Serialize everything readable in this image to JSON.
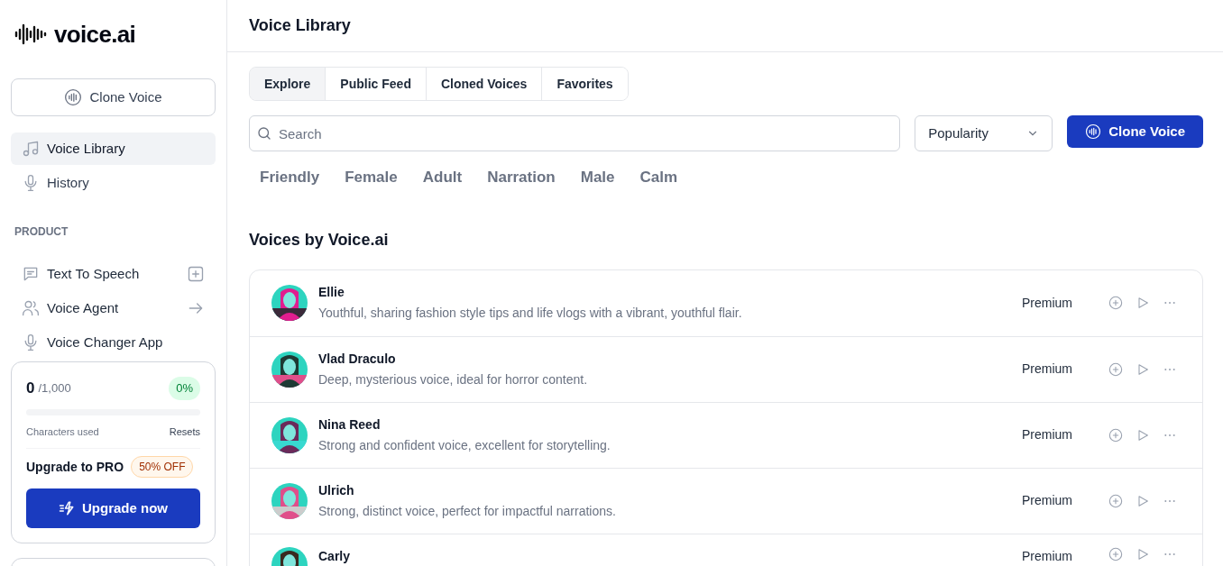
{
  "logo": {
    "text": "voice.ai"
  },
  "sidebar": {
    "clone_button": "Clone Voice",
    "nav": [
      {
        "label": "Voice Library",
        "selected": true
      },
      {
        "label": "History",
        "selected": false
      }
    ],
    "section_title": "PRODUCT",
    "product_items": [
      {
        "label": "Text To Speech"
      },
      {
        "label": "Voice Agent"
      },
      {
        "label": "Voice Changer App"
      }
    ],
    "usage": {
      "count": "0",
      "limit": "/1,000",
      "percent": "0%",
      "level": 0,
      "caption": "Characters used",
      "resets": "Resets",
      "upgrade_title": "Upgrade to PRO",
      "discount": "50% OFF",
      "upgrade_button": "Upgrade now"
    }
  },
  "header": {
    "title": "Voice Library"
  },
  "tabs": [
    {
      "label": "Explore",
      "selected": true
    },
    {
      "label": "Public Feed",
      "selected": false
    },
    {
      "label": "Cloned Voices",
      "selected": false
    },
    {
      "label": "Favorites",
      "selected": false
    }
  ],
  "search": {
    "placeholder": "Search"
  },
  "sort": {
    "value": "Popularity"
  },
  "clone_button": "Clone Voice",
  "filters": [
    "Friendly",
    "Female",
    "Adult",
    "Narration",
    "Male",
    "Calm"
  ],
  "section_title": "Voices by Voice.ai",
  "voices": [
    {
      "name": "Ellie",
      "description": "Youthful, sharing fashion style tips and life vlogs with a vibrant, youthful flair.",
      "tier": "Premium"
    },
    {
      "name": "Vlad Draculo",
      "description": "Deep, mysterious voice, ideal for horror content.",
      "tier": "Premium"
    },
    {
      "name": "Nina Reed",
      "description": "Strong and confident voice, excellent for storytelling.",
      "tier": "Premium"
    },
    {
      "name": "Ulrich",
      "description": "Strong, distinct voice, perfect for impactful narrations.",
      "tier": "Premium"
    },
    {
      "name": "Carly",
      "tier": "Premium"
    }
  ]
}
